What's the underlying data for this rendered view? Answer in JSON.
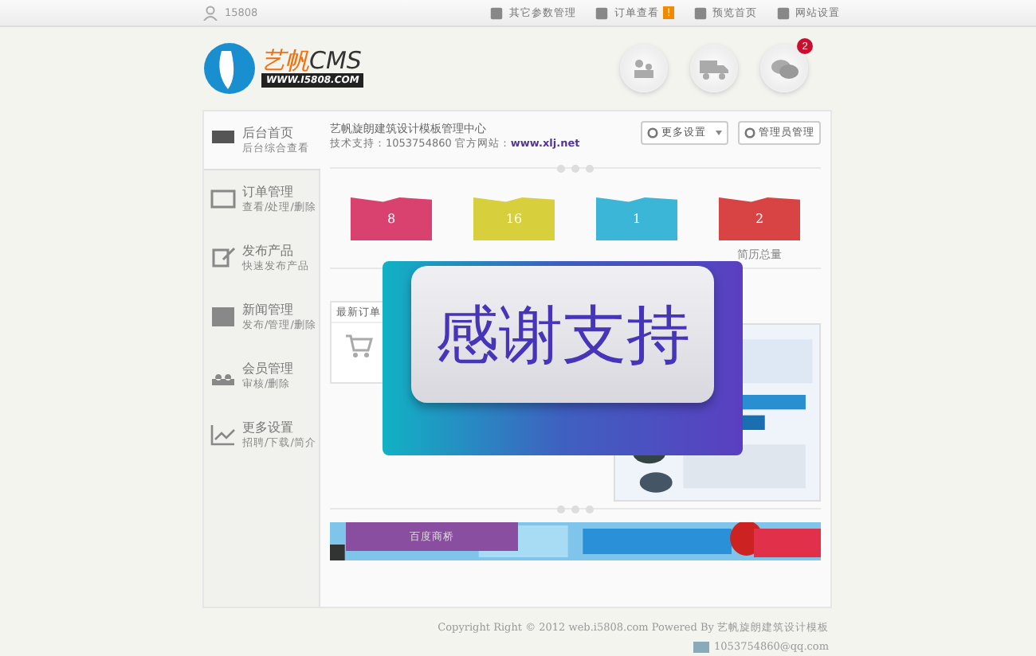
{
  "topbar": {
    "user": "15808",
    "links": [
      {
        "label": "其它参数管理"
      },
      {
        "label": "订单查看",
        "badge": "!"
      },
      {
        "label": "预览首页"
      },
      {
        "label": "网站设置"
      }
    ]
  },
  "logo": {
    "name": "艺帆",
    "suffix": "CMS",
    "url": "WWW.I5808.COM"
  },
  "messages_badge": "2",
  "sidebar": [
    {
      "title": "后台首页",
      "sub": "后台综合查看",
      "selected": true
    },
    {
      "title": "订单管理",
      "sub": "查看/处理/删除",
      "selected": false
    },
    {
      "title": "发布产品",
      "sub": "快速发布产品",
      "selected": false
    },
    {
      "title": "新闻管理",
      "sub": "发布/管理/删除",
      "selected": false
    },
    {
      "title": "会员管理",
      "sub": "审核/删除",
      "selected": false
    },
    {
      "title": "更多设置",
      "sub": "招聘/下载/简介",
      "selected": false
    }
  ],
  "site": {
    "title": "艺帆旋朗建筑设计模板管理中心",
    "support": "技术支持：1053754860 官方网站：",
    "link": "www.xlj.net"
  },
  "buttons": [
    {
      "label": "更多设置"
    },
    {
      "label": "管理员管理"
    }
  ],
  "stats": [
    {
      "value": "8",
      "color": "#d9416e"
    },
    {
      "value": "16",
      "color": "#d8cf3c"
    },
    {
      "value": "1",
      "color": "#3bb6d6"
    },
    {
      "value": "2",
      "color": "#d84444",
      "label": "简历总量"
    }
  ],
  "orders_panel": {
    "title": "最新订单"
  },
  "overlay": {
    "text": "感谢支持"
  },
  "chat_widget": {
    "label": "百度商桥"
  },
  "footer": {
    "copyright": "Copyright Right © 2012 web.i5808.com Powered By 艺帆旋朗建筑设计模板",
    "email": "1053754860@qq.com"
  }
}
